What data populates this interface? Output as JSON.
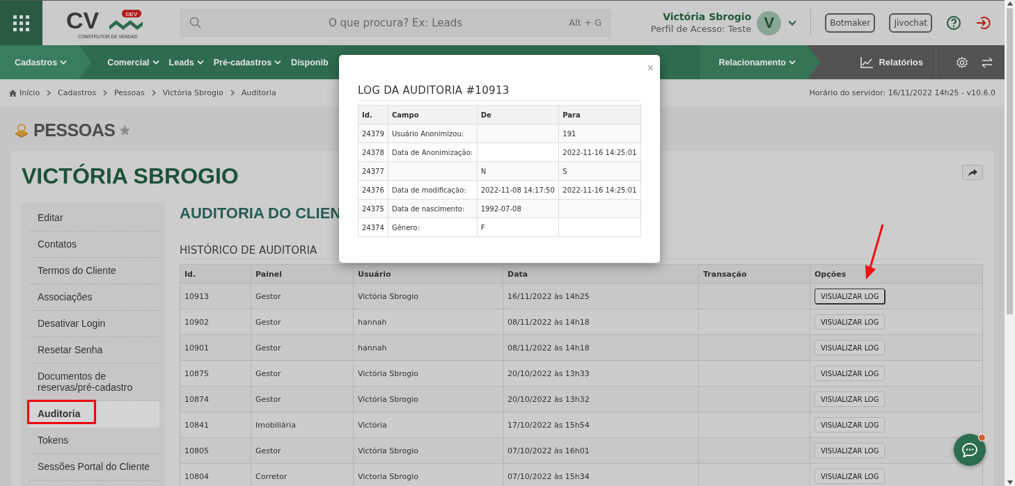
{
  "header": {
    "logo": {
      "letters": "CV",
      "badge": "DEV",
      "tagline": "CONSTRUTOR DE VENDAS"
    },
    "search": {
      "placeholder": "O que procura? Ex: Leads",
      "shortcut": "Alt + G"
    },
    "user": {
      "name": "Victória Sbrogio",
      "profile": "Perfil de Acesso: Teste",
      "avatar_letter": "V"
    },
    "buttons": [
      "Botmaker",
      "Jivochat"
    ]
  },
  "nav": {
    "items": [
      {
        "label": "Cadastros",
        "selected": true
      },
      {
        "label": "Comercial",
        "selected": false
      },
      {
        "label": "Leads",
        "selected": false
      },
      {
        "label": "Pré-cadastros",
        "selected": false
      },
      {
        "label": "Disponib",
        "selected": false
      },
      {
        "label": "Relacionamento",
        "selected": false
      }
    ],
    "reports": "Relatórios"
  },
  "breadcrumb": {
    "items": [
      "Início",
      "Cadastros",
      "Pessoas",
      "Victória Sbrogio",
      "Auditoria"
    ],
    "server_time": "Horário do servidor: 16/11/2022 14h25 - v10.6.0"
  },
  "page_title": "PESSOAS",
  "person_name": "VICTÓRIA SBROGIO",
  "sidebar": {
    "items": [
      {
        "label": "Editar",
        "selected": false
      },
      {
        "label": "Contatos",
        "selected": false
      },
      {
        "label": "Termos do Cliente",
        "selected": false
      },
      {
        "label": "Associações",
        "selected": false
      },
      {
        "label": "Desativar Login",
        "selected": false
      },
      {
        "label": "Resetar Senha",
        "selected": false
      },
      {
        "label": "Documentos de reservas/pré-cadastro",
        "selected": false
      },
      {
        "label": "Auditoria",
        "selected": true
      },
      {
        "label": "Tokens",
        "selected": false
      },
      {
        "label": "Sessões Portal do Cliente",
        "selected": false
      }
    ]
  },
  "content": {
    "title": "AUDITORIA DO CLIEN",
    "section_title": "HISTÓRICO DE AUDITORIA",
    "table": {
      "columns": [
        "Id.",
        "Painel",
        "Usuário",
        "Data",
        "Transação",
        "Opções"
      ],
      "rows": [
        {
          "id": "10913",
          "painel": "Gestor",
          "usuario": "Victória Sbrogio",
          "data": "16/11/2022 às 14h25",
          "action": "VISUALIZAR LOG",
          "focused": true
        },
        {
          "id": "10902",
          "painel": "Gestor",
          "usuario": "hannah",
          "data": "08/11/2022 às 14h18",
          "action": "VISUALIZAR LOG",
          "focused": false
        },
        {
          "id": "10901",
          "painel": "Gestor",
          "usuario": "hannah",
          "data": "08/11/2022 às 14h18",
          "action": "VISUALIZAR LOG",
          "focused": false
        },
        {
          "id": "10875",
          "painel": "Gestor",
          "usuario": "Victória Sbrogio",
          "data": "20/10/2022 às 13h33",
          "action": "VISUALIZAR LOG",
          "focused": false
        },
        {
          "id": "10874",
          "painel": "Gestor",
          "usuario": "Victória Sbrogio",
          "data": "20/10/2022 às 13h32",
          "action": "VISUALIZAR LOG",
          "focused": false
        },
        {
          "id": "10841",
          "painel": "Imobiliária",
          "usuario": "Victória",
          "data": "17/10/2022 às 15h54",
          "action": "VISUALIZAR LOG",
          "focused": false
        },
        {
          "id": "10805",
          "painel": "Gestor",
          "usuario": "Victória Sbrogio",
          "data": "07/10/2022 às 16h01",
          "action": "VISUALIZAR LOG",
          "focused": false
        },
        {
          "id": "10804",
          "painel": "Corretor",
          "usuario": "Victoria Sbrogio",
          "data": "07/10/2022 às 15h34",
          "action": "VISUALIZAR LOG",
          "focused": false
        }
      ]
    }
  },
  "modal": {
    "title": "LOG DA AUDITORIA #10913",
    "close": "×",
    "columns": [
      "Id.",
      "Campo",
      "De",
      "Para"
    ],
    "rows": [
      [
        "24379",
        "Usuário Anonimizou:",
        "",
        "191"
      ],
      [
        "24378",
        "Data de Anonimização:",
        "",
        "2022-11-16 14:25:01"
      ],
      [
        "24377",
        "",
        "N",
        "S"
      ],
      [
        "24376",
        "Data de modificação:",
        "2022-11-08 14:17:50",
        "2022-11-16 14:25:01"
      ],
      [
        "24375",
        "Data de nascimento:",
        "1992-07-08",
        ""
      ],
      [
        "24374",
        "Gênero:",
        "F",
        ""
      ]
    ]
  },
  "chat": {
    "unread": true
  },
  "annotations": {
    "highlight_box": true,
    "arrow": true
  }
}
